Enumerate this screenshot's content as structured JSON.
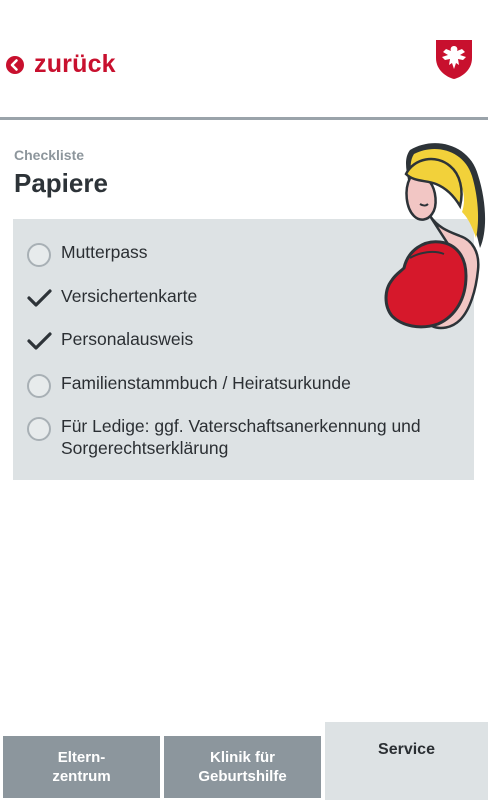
{
  "header": {
    "back_label": "zurück"
  },
  "page": {
    "subtitle": "Checkliste",
    "title": "Papiere"
  },
  "checklist": {
    "items": [
      {
        "label": "Mutterpass",
        "checked": false
      },
      {
        "label": "Versichertenkarte",
        "checked": true
      },
      {
        "label": "Personalausweis",
        "checked": true
      },
      {
        "label": "Familienstammbuch / Heiratsurkunde",
        "checked": false
      },
      {
        "label": "Für Ledige: ggf. Vaterschaftsanerkennung und Sorgerechtserklärung",
        "checked": false
      }
    ]
  },
  "tabs": {
    "eltern": "Eltern- zentrum",
    "klinik": "Klinik für Geburtshilfe",
    "service": "Service"
  },
  "colors": {
    "accent": "#c8102e",
    "panel": "#dde2e4",
    "tab_inactive": "#8c969d",
    "rule": "#9aa3aa"
  }
}
